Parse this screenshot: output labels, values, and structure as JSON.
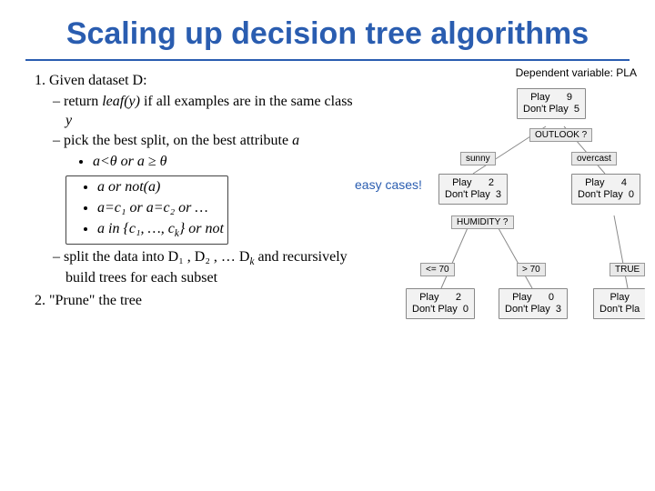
{
  "title": "Scaling up decision tree algorithms",
  "steps": {
    "s1": "Given dataset D:",
    "s1a_pre": "return ",
    "s1a_leaf": "leaf(y)",
    "s1a_post": " if all examples are in the same class ",
    "s1a_y": "y",
    "s1b": "pick the best split, on the best attribute ",
    "s1b_a": "a",
    "b1": "a<θ  or  a ≥ θ",
    "b2_pre": "a  or ",
    "b2_not": "not(a)",
    "b3": "a=c₁ or a=c₂ or …",
    "b4_pre": "a in {c",
    "b4_mid": "₁, …, c",
    "b4_k": "k",
    "b4_post": "} or not",
    "s1c_pre": "split the data into D",
    "s1c_mid1": "₁ , D",
    "s1c_mid2": "₂ , … D",
    "s1c_k": "k",
    "s1c_post": " and recursively build trees for each subset",
    "s2": "\"Prune\" the tree"
  },
  "easy": "easy cases!",
  "diagram": {
    "depvar": "Dependent variable: PLA",
    "root_play": "Play",
    "root_play_n": "9",
    "root_dont": "Don't Play",
    "root_dont_n": "5",
    "q_outlook": "OUTLOOK ?",
    "e_sunny": "sunny",
    "e_overcast": "overcast",
    "n1_play": "Play",
    "n1_play_n": "2",
    "n1_dont": "Don't Play",
    "n1_dont_n": "3",
    "n2_play": "Play",
    "n2_play_n": "4",
    "n2_dont": "Don't Play",
    "n2_dont_n": "0",
    "q_humidity": "HUMIDITY ?",
    "e_le70": "<= 70",
    "e_gt70": "> 70",
    "e_true": "TRUE",
    "l1_play": "Play",
    "l1_play_n": "2",
    "l1_dont": "Don't Play",
    "l1_dont_n": "0",
    "l2_play": "Play",
    "l2_play_n": "0",
    "l2_dont": "Don't Play",
    "l2_dont_n": "3",
    "l3_play": "Play",
    "l3_dont": "Don't Pla"
  }
}
